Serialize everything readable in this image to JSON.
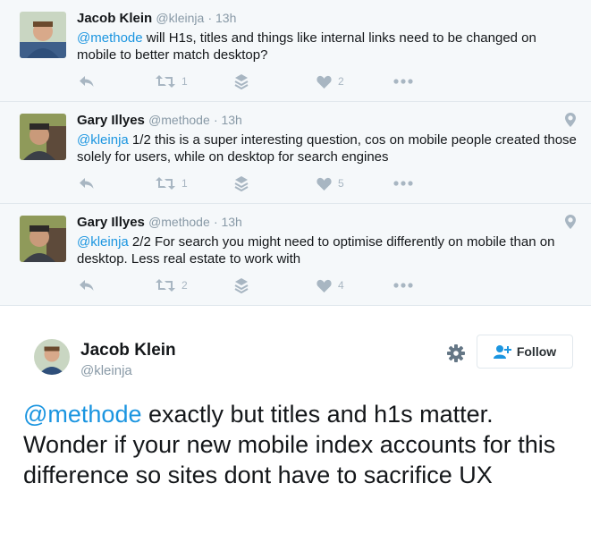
{
  "replies": [
    {
      "name": "Jacob Klein",
      "handle": "@kleinja",
      "time": "· 13h",
      "mention": "@methode",
      "text": " will H1s, titles and things like internal links need to be changed on mobile to better match desktop?",
      "retweets": "1",
      "likes": "2",
      "has_location": false
    },
    {
      "name": "Gary Illyes",
      "handle": "@methode",
      "time": "· 13h",
      "mention": "@kleinja",
      "text": " 1/2 this is a super interesting question, cos on mobile people created those solely for users, while on desktop for search engines",
      "retweets": "1",
      "likes": "5",
      "has_location": true
    },
    {
      "name": "Gary Illyes",
      "handle": "@methode",
      "time": "· 13h",
      "mention": "@kleinja",
      "text": " 2/2 For search you might need to optimise differently on mobile than on desktop. Less real estate to work with",
      "retweets": "2",
      "likes": "4",
      "has_location": true
    }
  ],
  "main_tweet": {
    "name": "Jacob Klein",
    "handle": "@kleinja",
    "follow_label": "Follow",
    "mention": "@methode",
    "text": " exactly but titles and h1s matter. Wonder if your new mobile index accounts for this difference so sites dont have to sacrifice UX"
  },
  "colors": {
    "link": "#1b95e0",
    "icon": "#a8b6c2",
    "reply_bg": "#f5f8fa"
  }
}
